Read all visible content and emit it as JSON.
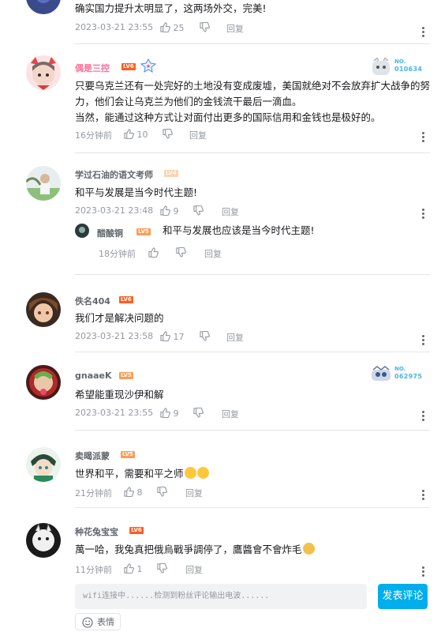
{
  "comments": [
    {
      "text": "确实国力提升太明显了，这两场外交，完美!",
      "time": "2023-03-21 23:55",
      "likes": "25",
      "reply": "回复"
    },
    {
      "username": "偶是三控",
      "level": "LV6",
      "fan_no": "NO.",
      "fan_num": "010634",
      "text": "只要乌克兰还有一处完好的土地没有变成废墟，美国就绝对不会放弃扩大战争的努力，他们会让乌克兰为他们的金钱流干最后一滴血。\n当然，能通过这种方式让对面付出更多的国际信用和金钱也是极好的。",
      "time": "16分钟前",
      "likes": "10",
      "reply": "回复"
    },
    {
      "username": "学过石油的语文考师",
      "level": "LV4",
      "text": "和平与发展是当今时代主题!",
      "time": "2023-03-21 23:48",
      "likes": "9",
      "reply": "回复",
      "sub_reply": {
        "username": "醋酸铜",
        "level": "LV5",
        "text": "和平与发展也应该是当今时代主题!",
        "time": "18分钟前",
        "reply": "回复"
      }
    },
    {
      "username": "佚名404",
      "level": "LV6",
      "text": "我们才是解决问题的",
      "time": "2023-03-21 23:58",
      "likes": "17",
      "reply": "回复"
    },
    {
      "username": "gnaaeK",
      "level": "LV5",
      "fan_no": "NO.",
      "fan_num": "062975",
      "text": "希望能重现沙伊和解",
      "time": "2023-03-21 23:55",
      "likes": "9",
      "reply": "回复"
    },
    {
      "username": "卖暍派蒙",
      "level": "LV5",
      "text": "世界和平，需要和平之师",
      "time": "21分钟前",
      "likes": "8",
      "reply": "回复"
    },
    {
      "username": "种花兔宝宝",
      "level": "LV6",
      "text": "萬一哈，我兔真把俄烏戰爭調停了，鷹醬會不會炸毛",
      "time": "11分钟前",
      "likes": "1",
      "reply": "回复"
    }
  ],
  "composer": {
    "placeholder": "wifi连接中......检测到粉丝评论输出电波......",
    "send_label": "发表评论",
    "emoji_label": "表情"
  },
  "icons": {
    "like": "thumbs-up-icon",
    "dislike": "thumbs-down-icon",
    "more": "more-vertical-icon",
    "emoji": "smiley-icon"
  },
  "colors": {
    "accent": "#00aeec",
    "level6": "#ff5c21",
    "level5": "#ff9b55",
    "vip_name": "#fb7299",
    "meta": "#9499a0"
  }
}
